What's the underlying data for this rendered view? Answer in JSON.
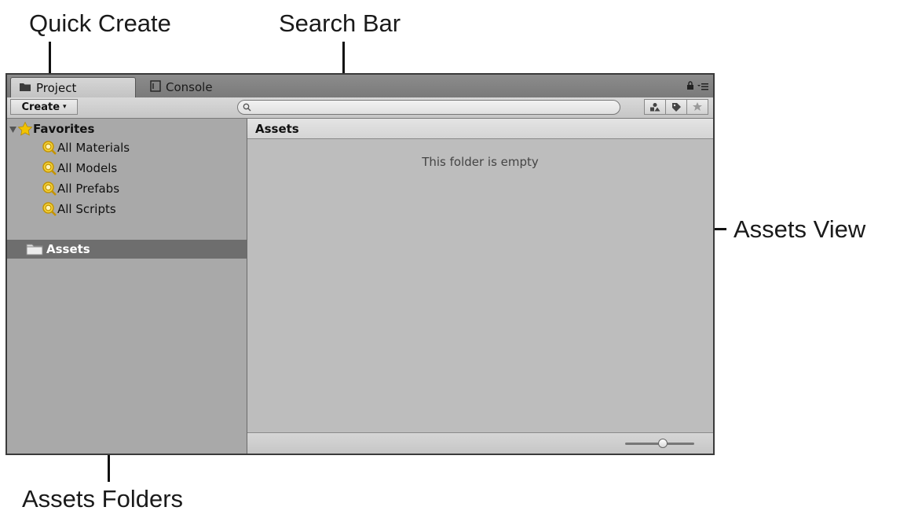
{
  "callouts": {
    "quick_create": "Quick Create",
    "search_bar": "Search Bar",
    "assets_view": "Assets View",
    "assets_folders": "Assets Folders"
  },
  "tabs": [
    {
      "label": "Project",
      "icon": "folder-icon",
      "active": true
    },
    {
      "label": "Console",
      "icon": "console-icon",
      "active": false
    }
  ],
  "toolbar": {
    "create_label": "Create",
    "create_arrow": "▾",
    "search_value": "",
    "filters": [
      "filter-by-type-icon",
      "filter-by-label-icon",
      "favorite-star-icon"
    ]
  },
  "tree": {
    "favorites_label": "Favorites",
    "favorites_items": [
      "All Materials",
      "All Models",
      "All Prefabs",
      "All Scripts"
    ],
    "assets_label": "Assets"
  },
  "assets_view": {
    "header": "Assets",
    "empty_message": "This folder is empty",
    "zoom_level": 0.55
  },
  "colors": {
    "selection": "#6e6e6e",
    "favorite_star": "#f2c300",
    "search_icon_gold": "#d9a400"
  }
}
